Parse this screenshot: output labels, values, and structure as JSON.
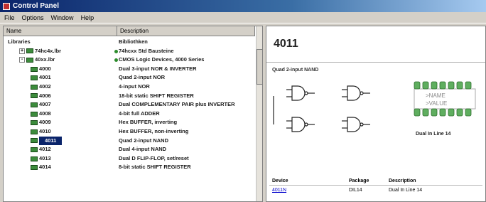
{
  "window": {
    "title": "Control Panel"
  },
  "menu": [
    "File",
    "Options",
    "Window",
    "Help"
  ],
  "tree": {
    "col_name": "Name",
    "col_description": "Description",
    "rows": [
      {
        "name": "Libraries",
        "desc": "Bibliothken",
        "level": 0,
        "expander": "",
        "chip": false,
        "dot": false
      },
      {
        "name": "74hc4x.lbr",
        "desc": "74hcxx Std Bausteine",
        "level": 1,
        "expander": "+",
        "chip": true,
        "dot": true
      },
      {
        "name": "40xx.lbr",
        "desc": "CMOS Logic Devices, 4000 Series",
        "level": 1,
        "expander": "-",
        "chip": true,
        "dot": true
      },
      {
        "name": "4000",
        "desc": "Dual 3-input NOR & INVERTER",
        "level": 2,
        "expander": "",
        "chip": true,
        "dot": false
      },
      {
        "name": "4001",
        "desc": "Quad 2-input NOR",
        "level": 2,
        "expander": "",
        "chip": true,
        "dot": false
      },
      {
        "name": "4002",
        "desc": "4-input NOR",
        "level": 2,
        "expander": "",
        "chip": true,
        "dot": false
      },
      {
        "name": "4006",
        "desc": "18-bit static SHIFT REGISTER",
        "level": 2,
        "expander": "",
        "chip": true,
        "dot": false
      },
      {
        "name": "4007",
        "desc": "Dual COMPLEMENTARY PAIR plus INVERTER",
        "level": 2,
        "expander": "",
        "chip": true,
        "dot": false
      },
      {
        "name": "4008",
        "desc": "4-bit full ADDER",
        "level": 2,
        "expander": "",
        "chip": true,
        "dot": false
      },
      {
        "name": "4009",
        "desc": "Hex BUFFER, inverting",
        "level": 2,
        "expander": "",
        "chip": true,
        "dot": false
      },
      {
        "name": "4010",
        "desc": "Hex BUFFER, non-inverting",
        "level": 2,
        "expander": "",
        "chip": true,
        "dot": false
      },
      {
        "name": "4011",
        "desc": "Quad 2-input NAND",
        "level": 2,
        "expander": "",
        "chip": true,
        "dot": false,
        "selected": true
      },
      {
        "name": "4012",
        "desc": "Dual 4-input NAND",
        "level": 2,
        "expander": "",
        "chip": true,
        "dot": false
      },
      {
        "name": "4013",
        "desc": "Dual D FLIP-FLOP, set/reset",
        "level": 2,
        "expander": "",
        "chip": true,
        "dot": false
      },
      {
        "name": "4014",
        "desc": "8-bit static SHIFT REGISTER",
        "level": 2,
        "expander": "",
        "chip": true,
        "dot": false
      }
    ]
  },
  "detail": {
    "part": "4011",
    "subtitle": "Quad 2-input NAND",
    "package_label": "Dual In Line 14",
    "chip_name": ">NAME",
    "chip_value": ">VALUE",
    "table_headers": [
      "Device",
      "Package",
      "Description"
    ],
    "table_row": [
      "4011N",
      "DIL14",
      "Dual In Line 14"
    ]
  }
}
